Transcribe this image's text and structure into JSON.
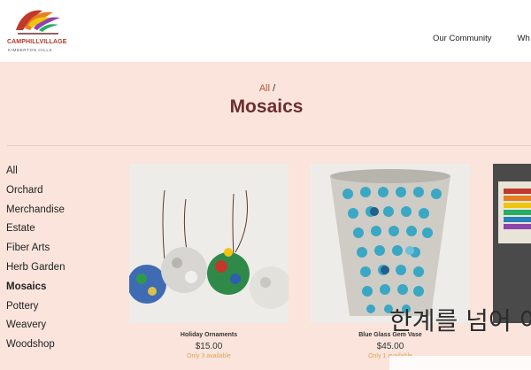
{
  "header": {
    "logo": {
      "name": "CAMPHILLVILLAGE",
      "subtitle": "KIMBERTON HILLS"
    },
    "nav": [
      "Our Community",
      "Wh"
    ]
  },
  "breadcrumb": {
    "link": "All",
    "separator": "/"
  },
  "page_title": "Mosaics",
  "sidebar": {
    "items": [
      "All",
      "Orchard",
      "Merchandise",
      "Estate",
      "Fiber Arts",
      "Herb Garden",
      "Mosaics",
      "Pottery",
      "Weavery",
      "Woodshop"
    ],
    "active": "Mosaics"
  },
  "products": [
    {
      "name": "Holiday Ornaments",
      "price": "$15.00",
      "availability": "Only 3 available"
    },
    {
      "name": "Blue Glass Gem Vase",
      "price": "$45.00",
      "availability": "Only 1 available"
    }
  ],
  "watermark": {
    "text": "한계를 넘어 이음"
  },
  "colors": {
    "background": "#fae4dc",
    "header_bg": "#ffffff",
    "title": "#6b2f2f",
    "breadcrumb_link": "#b0583a",
    "availability": "#e0a35a"
  },
  "icons": {
    "logo": "tree-logo",
    "product_1": "ornaments-photo",
    "product_2": "mosaic-vase-photo",
    "product_3": "mosaic-tiles-photo"
  }
}
